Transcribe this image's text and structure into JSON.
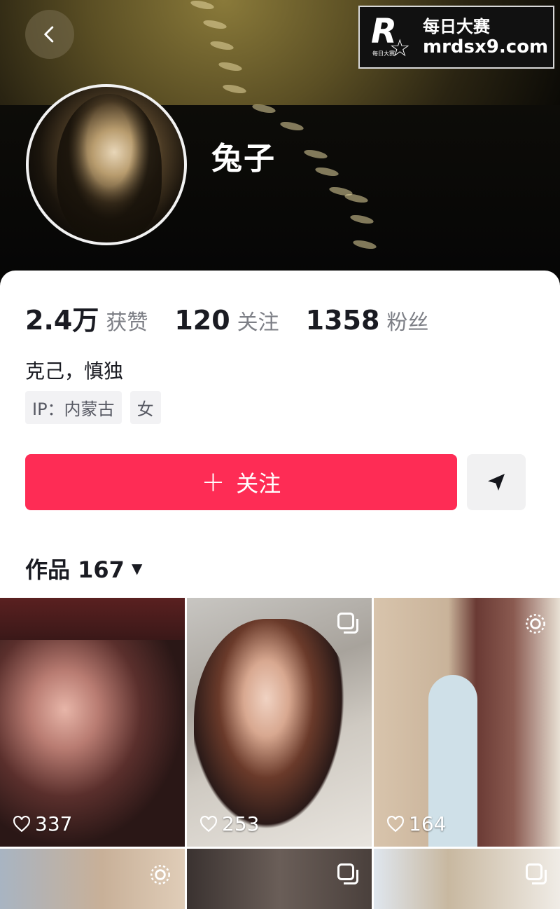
{
  "header": {
    "back_icon": "chevron-left-icon",
    "username": "兔子"
  },
  "watermark": {
    "logo_letter": "R",
    "logo_small": "每日大赛",
    "title": "每日大赛",
    "url": "mrdsx9.com"
  },
  "stats": [
    {
      "value": "2.4万",
      "label": "获赞"
    },
    {
      "value": "120",
      "label": "关注"
    },
    {
      "value": "1358",
      "label": "粉丝"
    }
  ],
  "bio": "克己，慎独",
  "tags": [
    "IP：内蒙古",
    "女"
  ],
  "actions": {
    "follow_label": "关注",
    "follow_icon": "plus-icon",
    "share_icon": "send-icon"
  },
  "works": {
    "label": "作品 167",
    "caret_icon": "caret-down-icon"
  },
  "posts": [
    {
      "likes": "337",
      "badge": ""
    },
    {
      "likes": "253",
      "badge": "gallery-icon"
    },
    {
      "likes": "164",
      "badge": "live-icon"
    },
    {
      "likes": "",
      "badge": "live-icon"
    },
    {
      "likes": "",
      "badge": "gallery-icon"
    },
    {
      "likes": "",
      "badge": "gallery-icon"
    }
  ],
  "colors": {
    "accent": "#fe2c55",
    "text_primary": "#1a1b22",
    "text_secondary": "#7d7f86"
  }
}
